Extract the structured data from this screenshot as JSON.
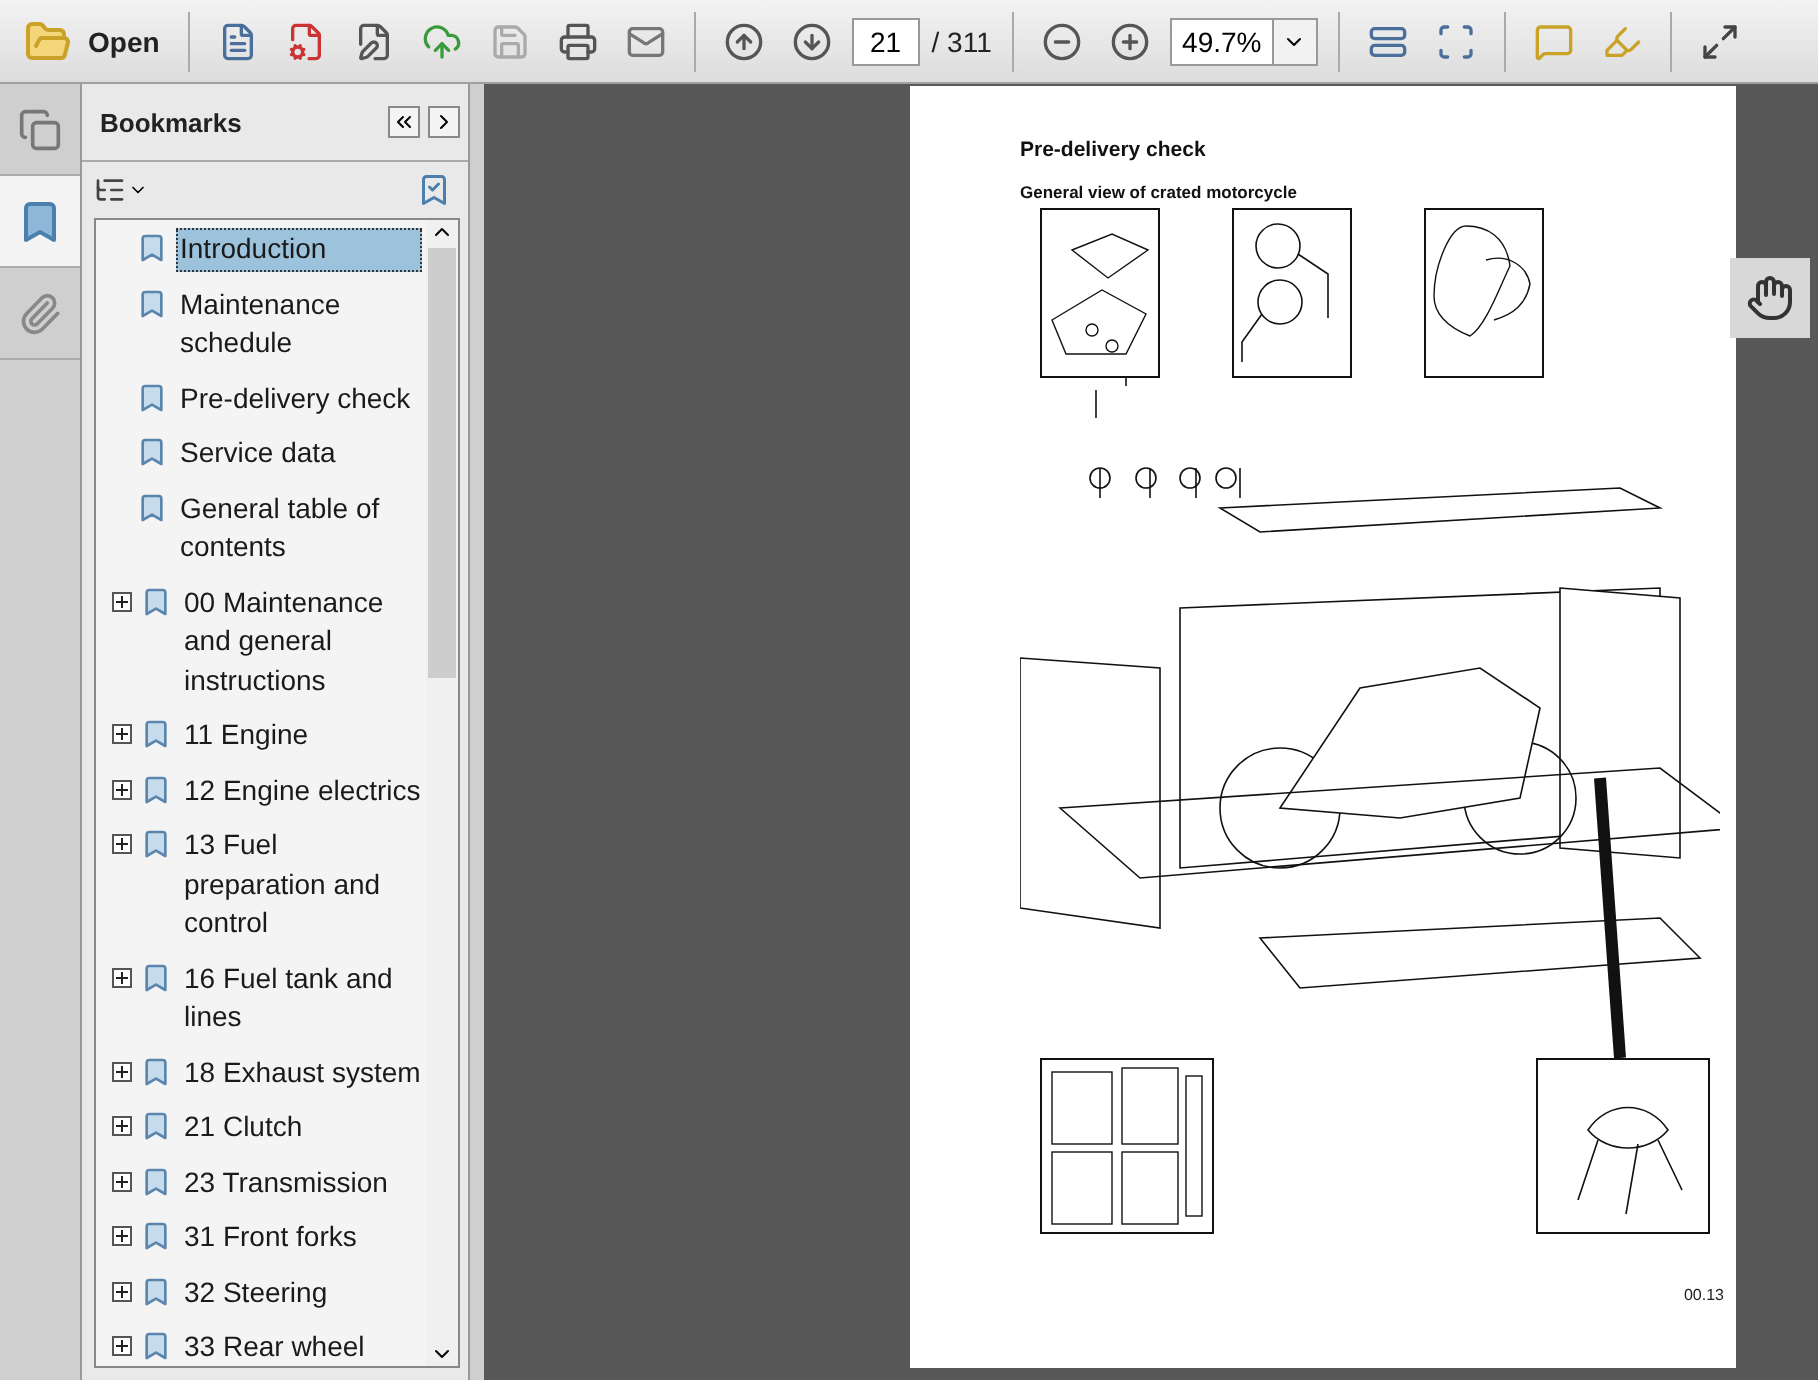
{
  "toolbar": {
    "open_label": "Open",
    "page_number": "21",
    "page_total": "/ 311",
    "zoom": "49.7%"
  },
  "side_tabs": [
    {
      "kind": "pages",
      "selected": false
    },
    {
      "kind": "bookmarks",
      "selected": true
    },
    {
      "kind": "attachments",
      "selected": false
    }
  ],
  "bookmarks_panel": {
    "title": "Bookmarks",
    "items": [
      {
        "label": "Introduction",
        "selected": true
      },
      {
        "label": "Maintenance schedule",
        "selected": false
      },
      {
        "label": "Pre-delivery check",
        "selected": false
      },
      {
        "label": "Service data",
        "selected": false
      },
      {
        "label": "General table of contents",
        "selected": false
      },
      {
        "label": "00 Maintenance and general instructions",
        "selected": false,
        "expanded": false
      },
      {
        "label": "11 Engine",
        "selected": false,
        "expanded": false
      },
      {
        "label": "12 Engine electrics",
        "selected": false,
        "expanded": false
      },
      {
        "label": "13 Fuel preparation and control",
        "selected": false,
        "expanded": false
      },
      {
        "label": "16 Fuel tank and lines",
        "selected": false,
        "expanded": false
      },
      {
        "label": "18 Exhaust system",
        "selected": false,
        "expanded": false
      },
      {
        "label": "21 Clutch",
        "selected": false,
        "expanded": false
      },
      {
        "label": "23 Transmission",
        "selected": false,
        "expanded": false
      },
      {
        "label": "31 Front forks",
        "selected": false,
        "expanded": false
      },
      {
        "label": "32 Steering",
        "selected": false,
        "expanded": false
      },
      {
        "label": "33 Rear wheel",
        "selected": false,
        "expanded": false
      }
    ]
  },
  "document_page": {
    "heading": "Pre-delivery check",
    "subheading": "General view of crated motorcycle",
    "page_label": "00.13"
  }
}
